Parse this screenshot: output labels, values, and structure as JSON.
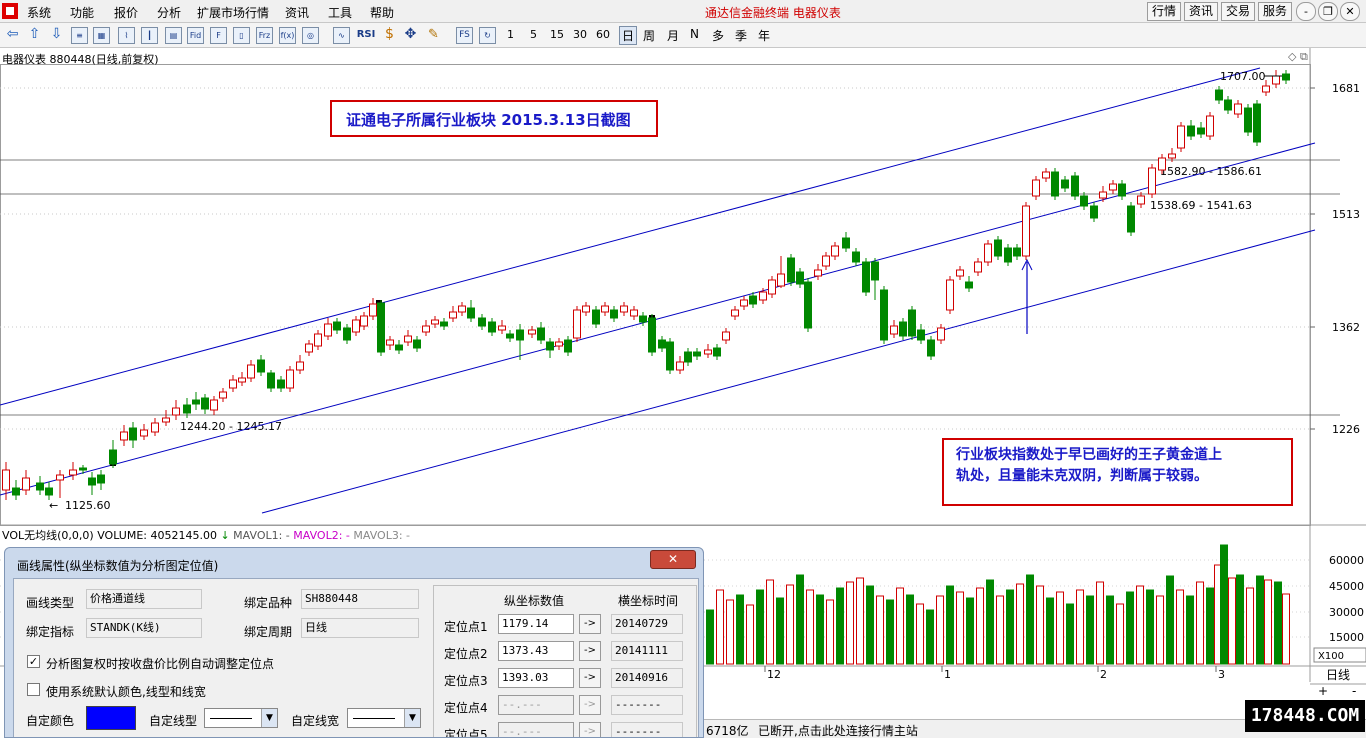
{
  "menu": {
    "items": [
      "系统",
      "功能",
      "报价",
      "分析",
      "扩展市场行情",
      "资讯",
      "工具",
      "帮助"
    ],
    "app_title": "通达信金融终端  电器仪表",
    "right_buttons": [
      "行情",
      "资讯",
      "交易",
      "服务"
    ],
    "window_controls": [
      "-",
      "❐",
      "✕"
    ]
  },
  "toolbar": {
    "period_numbers": [
      "1",
      "5",
      "15",
      "30",
      "60"
    ],
    "periods": [
      "日",
      "周",
      "月",
      "N",
      "多",
      "季",
      "年"
    ],
    "rsi_label": "RSI",
    "fs_label": "FS"
  },
  "chart": {
    "title": "电器仪表 880448(日线,前复权)",
    "annotation_1": "证通电子所属行业板块  2015.3.13日截图",
    "annotation_2_line1": "行业板块指数处于早已画好的王子黄金道上",
    "annotation_2_line2": "轨处，且量能未克双阴，判断属于较弱。",
    "price_labels": [
      "1681",
      "1513",
      "1362",
      "1226"
    ],
    "h_line_labels": [
      "1582.90 - 1586.61",
      "1538.69 - 1541.63",
      "1244.20 - 1245.17"
    ],
    "high_label": "1707.00",
    "low_label": "1125.60",
    "volume_header_left": "VOL无均线(0,0,0)",
    "volume_header_main": "VOLUME: 4052145.00",
    "mavol1": "MAVOL1: -",
    "mavol2": "MAVOL2: -",
    "mavol3": "MAVOL3: -",
    "volume_labels": [
      "60000",
      "45000",
      "30000",
      "15000"
    ],
    "volume_unit": "X100",
    "x_ticks": [
      "12",
      "1",
      "2",
      "3"
    ],
    "period_label": "日线",
    "zoom_controls": [
      "+",
      "-"
    ]
  },
  "chart_data": {
    "type": "candlestick",
    "title": "电器仪表 880448(日线,前复权)",
    "y_price_ticks": [
      1226,
      1362,
      1513,
      1681
    ],
    "y_volume_ticks": [
      15000,
      30000,
      45000,
      60000
    ],
    "volume_unit": "X100",
    "high": 1707.0,
    "low": 1125.6,
    "channel_anchor_points": [
      {
        "label": "定位点1",
        "value": 1179.14,
        "date": "20140729"
      },
      {
        "label": "定位点2",
        "value": 1373.43,
        "date": "20141111"
      },
      {
        "label": "定位点3",
        "value": 1393.03,
        "date": "20140916"
      }
    ],
    "horizontal_levels": [
      {
        "label": "1582.90 - 1586.61",
        "value": 1584
      },
      {
        "label": "1538.69 - 1541.63",
        "value": 1540
      },
      {
        "label": "1244.20 - 1245.17",
        "value": 1245
      }
    ],
    "last_volume": 4052145.0
  },
  "dialog": {
    "title": "画线属性(纵坐标数值为分析图定位值)",
    "close": "✕",
    "line_type_label": "画线类型",
    "line_type_value": "价格通道线",
    "bind_symbol_label": "绑定品种",
    "bind_symbol_value": "SH880448",
    "bind_indicator_label": "绑定指标",
    "bind_indicator_value": "STANDK(K线)",
    "bind_period_label": "绑定周期",
    "bind_period_value": "日线",
    "checkbox_1": "分析图复权时按收盘价比例自动调整定位点",
    "checkbox_2": "使用系统默认颜色,线型和线宽",
    "color_label": "自定颜色",
    "line_style_label": "自定线型",
    "line_width_label": "自定线宽",
    "col_value_header": "纵坐标数值",
    "col_time_header": "横坐标时间",
    "anchors": [
      {
        "label": "定位点1",
        "value": "1179.14",
        "date": "20140729"
      },
      {
        "label": "定位点2",
        "value": "1373.43",
        "date": "20141111"
      },
      {
        "label": "定位点3",
        "value": "1393.03",
        "date": "20140916"
      },
      {
        "label": "定位点4",
        "value": "--.---",
        "date": "-------"
      },
      {
        "label": "定位点5",
        "value": "--.---",
        "date": "-------"
      }
    ],
    "arrow_label": "->"
  },
  "status": {
    "amount": "6718亿",
    "message": "已断开,点击此处连接行情主站"
  },
  "watermark": "178448.COM",
  "colors": {
    "up": "#d00000",
    "down": "#008800",
    "channel": "#0000c0",
    "annotation_border": "#d00000",
    "annotation_text": "#1a1ac8"
  }
}
